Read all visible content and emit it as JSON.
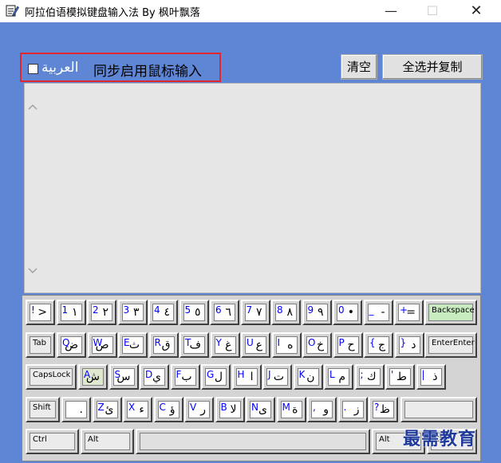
{
  "window": {
    "title": "阿拉伯语模拟键盘输入法 By 枫叶飘落",
    "minimize_glyph": "—",
    "maximize_glyph": "☐",
    "close_glyph": "✕"
  },
  "options": {
    "arabic_label": "العربية",
    "sync_mouse_label": "同步启用鼠标输入",
    "checked": false
  },
  "toolbar": {
    "clear_label": "清空",
    "select_copy_label": "全选并复制"
  },
  "editor": {
    "value": ""
  },
  "keyboard": {
    "rows": [
      [
        {
          "lat": "!",
          "ar": ">"
        },
        {
          "lat": "1",
          "ar": "١"
        },
        {
          "lat": "2",
          "ar": "٢"
        },
        {
          "lat": "3",
          "ar": "٣"
        },
        {
          "lat": "4",
          "ar": "٤"
        },
        {
          "lat": "5",
          "ar": "٥"
        },
        {
          "lat": "6",
          "ar": "٦"
        },
        {
          "lat": "7",
          "ar": "٧"
        },
        {
          "lat": "8",
          "ar": "٨"
        },
        {
          "lat": "9",
          "ar": "٩"
        },
        {
          "lat": "0",
          "ar": "•"
        },
        {
          "lat": "_",
          "ar": "-"
        },
        {
          "lat": "+",
          "ar": "="
        },
        {
          "lbl": "Backspace"
        }
      ],
      [
        {
          "lbl": "Tab"
        },
        {
          "lat": "Q",
          "ar": "ض"
        },
        {
          "lat": "W",
          "ar": "ص"
        },
        {
          "lat": "E",
          "ar": "ث"
        },
        {
          "lat": "R",
          "ar": "ق"
        },
        {
          "lat": "T",
          "ar": "ف"
        },
        {
          "lat": "Y",
          "ar": "غ"
        },
        {
          "lat": "U",
          "ar": "ع"
        },
        {
          "lat": "I",
          "ar": "ه"
        },
        {
          "lat": "O",
          "ar": "خ"
        },
        {
          "lat": "P",
          "ar": "ح"
        },
        {
          "lat": "{",
          "ar": "ج"
        },
        {
          "lat": "}",
          "ar": "د"
        },
        {
          "lbl": "EnterEnter"
        }
      ],
      [
        {
          "lbl": "CapsLock"
        },
        {
          "lat": "A",
          "ar": "ش"
        },
        {
          "lat": "S",
          "ar": "س"
        },
        {
          "lat": "D",
          "ar": "ي"
        },
        {
          "lat": "F",
          "ar": "ب"
        },
        {
          "lat": "G",
          "ar": "ل"
        },
        {
          "lat": "H",
          "ar": "ا"
        },
        {
          "lat": "J",
          "ar": "ت"
        },
        {
          "lat": "K",
          "ar": "ن"
        },
        {
          "lat": "L",
          "ar": "م"
        },
        {
          "lat": ";",
          "ar": "ك"
        },
        {
          "lat": "'",
          "ar": "ط"
        },
        {
          "lat": "|",
          "ar": "ذ"
        }
      ],
      [
        {
          "lbl": "Shift"
        },
        {
          "lat": "",
          "ar": "."
        },
        {
          "lat": "Z",
          "ar": "ئ"
        },
        {
          "lat": "X",
          "ar": "ء"
        },
        {
          "lat": "C",
          "ar": "ؤ"
        },
        {
          "lat": "V",
          "ar": "ر"
        },
        {
          "lat": "B",
          "ar": "لا"
        },
        {
          "lat": "N",
          "ar": "ى"
        },
        {
          "lat": "M",
          "ar": "ة"
        },
        {
          "lat": ",",
          "ar": "و"
        },
        {
          "lat": ".",
          "ar": "ز"
        },
        {
          "lat": "?",
          "ar": "ظ"
        },
        {
          "lbl": ""
        }
      ],
      [
        {
          "lbl": "Ctrl"
        },
        {
          "lbl": "Alt"
        },
        {
          "lbl": ""
        },
        {
          "lbl": "Alt"
        },
        {
          "lbl": "Ctrl"
        }
      ]
    ]
  },
  "watermark": "最需教育"
}
